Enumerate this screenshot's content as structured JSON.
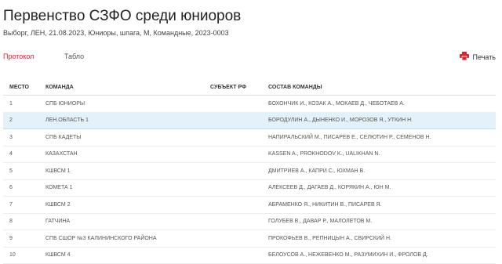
{
  "header": {
    "title": "Первенство СЗФО среди юниоров",
    "subtitle": "Выборг, ЛЕН, 21.08.2023, Юниоры, шпага, М, Командные, 2023-0003"
  },
  "tabs": [
    {
      "label": "Протокол"
    },
    {
      "label": "Табло"
    }
  ],
  "print": {
    "label": "Печать",
    "icon": "printer-icon",
    "icon_color": "#d6262e"
  },
  "table": {
    "columns": [
      "МЕСТО",
      "КОМАНДА",
      "СУБЪЕКТ РФ",
      "СОСТАВ КОМАНДЫ"
    ],
    "rows": [
      {
        "place": "1",
        "team": "СПБ ЮНИОРЫ",
        "region": "",
        "roster": "БОХОНЧИК И., КОЗАК А., МОКАЕВ Д., ЧЕБОТАЕВ А."
      },
      {
        "place": "2",
        "team": "ЛЕН.ОБЛАСТЬ 1",
        "region": "",
        "roster": "БОРОДУЛИН А., ДЫНЕНКО И., МОРОЗОВ Я., УТКИН Н."
      },
      {
        "place": "3",
        "team": "СПБ КАДЕТЫ",
        "region": "",
        "roster": "НАПИРАЛЬСКИЙ М., ПИСАРЕВ Е., СЕЛЮТИН Р., СЕМЕНОВ Н."
      },
      {
        "place": "4",
        "team": "КАЗАХСТАН",
        "region": "",
        "roster": "KASSEN A., PROKHODOV K., UALIKHAN N."
      },
      {
        "place": "5",
        "team": "КШВСМ 1",
        "region": "",
        "roster": "ДМИТРИЕВ А., КАПРИ С., ЮХМАН В."
      },
      {
        "place": "6",
        "team": "КОМЕТА 1",
        "region": "",
        "roster": "АЛЕКСЕЕВ Д., ДАГАЕВ Д., КОРЯКИН А., ЮН М."
      },
      {
        "place": "7",
        "team": "КШВСМ 2",
        "region": "",
        "roster": "АБРАМЕНКО Я., НИКИТИН В., ПИСАРЕВ Я."
      },
      {
        "place": "8",
        "team": "ГАТЧИНА",
        "region": "",
        "roster": "ГОЛУБЕВ В., ДАВАР Р., МАЛОЛЕТОВ М."
      },
      {
        "place": "9",
        "team": "СПБ СШОР №3 КАЛИНИНСКОГО РАЙОНА",
        "region": "",
        "roster": "ПРОКОФЬЕВ В., РЕПНИЦЫН А., СВИРСКИЙ Н."
      },
      {
        "place": "10",
        "team": "КШВСМ 4",
        "region": "",
        "roster": "БЕЛОУСОВ А., НЕЖЕВЕНКО М., РАЗУМИХИН И., ФРОЛОВ Д."
      }
    ]
  }
}
